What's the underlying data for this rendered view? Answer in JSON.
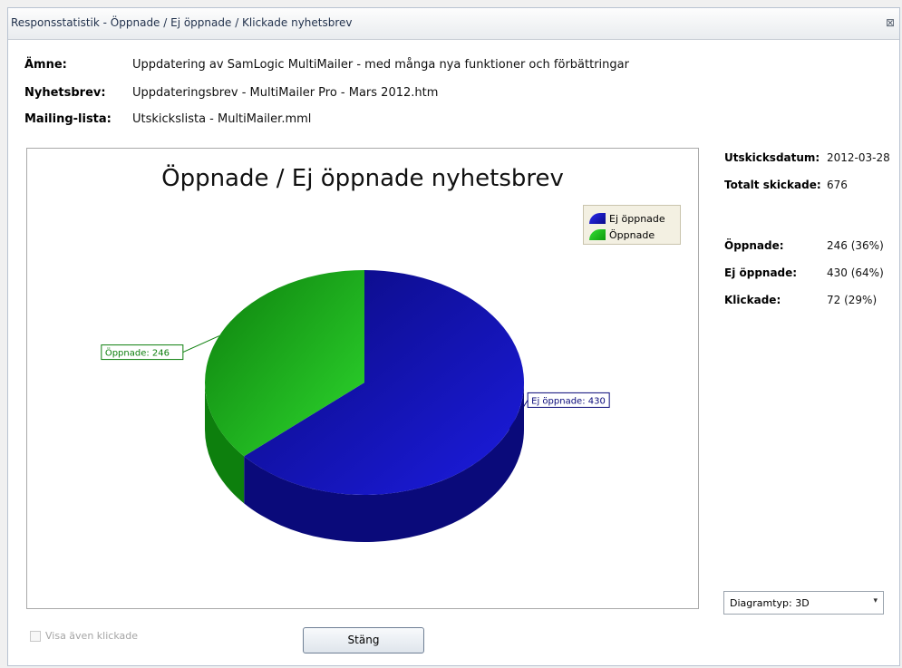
{
  "window": {
    "title": "Responsstatistik - Öppnade / Ej öppnade / Klickade nyhetsbrev",
    "close_glyph": "⊠"
  },
  "info": {
    "subject_label": "Ämne:",
    "subject_value": "Uppdatering av SamLogic MultiMailer - med många nya funktioner och förbättringar",
    "newsletter_label": "Nyhetsbrev:",
    "newsletter_value": "Uppdateringsbrev - MultiMailer Pro - Mars 2012.htm",
    "list_label": "Mailing-lista:",
    "list_value": "Utskickslista - MultiMailer.mml"
  },
  "stats": {
    "send_date_label": "Utskicksdatum:",
    "send_date_value": "2012-03-28",
    "total_label": "Totalt skickade:",
    "total_value": "676",
    "opened_label": "Öppnade:",
    "opened_value": "246 (36%)",
    "not_opened_label": "Ej öppnade:",
    "not_opened_value": "430 (64%)",
    "clicked_label": "Klickade:",
    "clicked_value": "72 (29%)"
  },
  "chart_data": {
    "type": "pie",
    "title": "Öppnade / Ej öppnade nyhetsbrev",
    "legend_position": "top-right",
    "slices": [
      {
        "name": "Ej öppnade",
        "value": 430,
        "label": "Ej öppnade: 430",
        "color": "#1c1ce0",
        "dark": "#0a0a7a"
      },
      {
        "name": "Öppnade",
        "value": 246,
        "label": "Öppnade: 246",
        "color": "#2ed82e",
        "dark": "#0d7f0d"
      }
    ]
  },
  "controls": {
    "chart_type_value": "Diagramtyp: 3D",
    "show_clicked_label": "Visa även klickade",
    "close_button_label": "Stäng"
  }
}
